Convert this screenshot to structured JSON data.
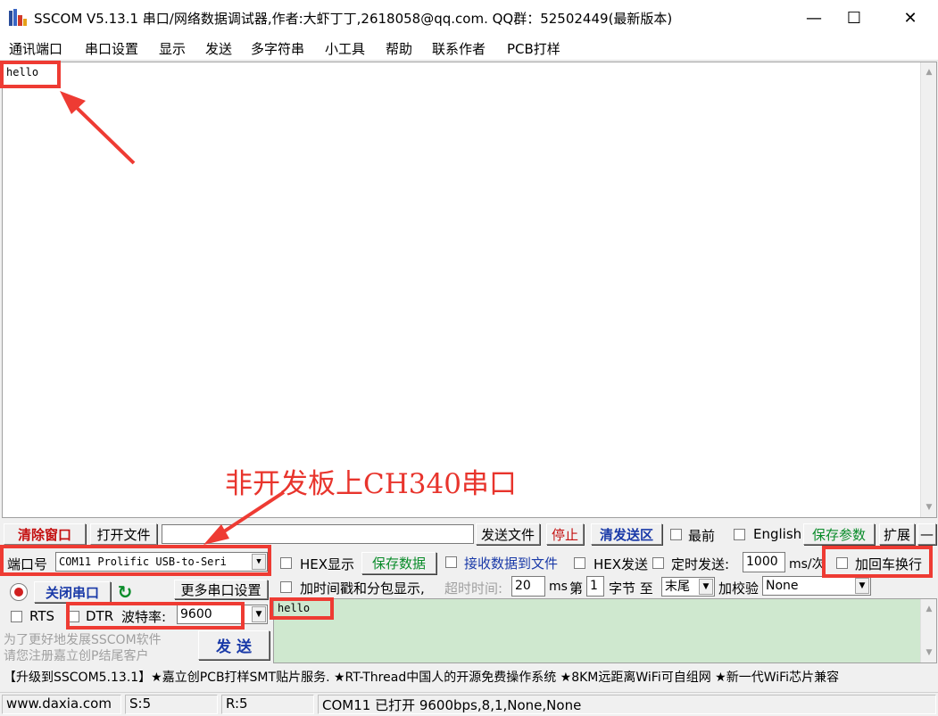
{
  "window": {
    "title": "SSCOM V5.13.1 串口/网络数据调试器,作者:大虾丁丁,2618058@qq.com. QQ群：52502449(最新版本)",
    "minimize": "—",
    "maximize": "☐",
    "close": "✕"
  },
  "menu": [
    "通讯端口",
    "串口设置",
    "显示",
    "发送",
    "多字符串",
    "小工具",
    "帮助",
    "联系作者",
    "PCB打样"
  ],
  "receive": {
    "text": "hello"
  },
  "annotation": {
    "text": "非开发板上CH340串口"
  },
  "row1": {
    "clear_window": "清除窗口",
    "open_file": "打开文件",
    "send_file": "发送文件",
    "stop": "停止",
    "clear_send": "清发送区",
    "last": "最前",
    "english": "English",
    "save_params": "保存参数",
    "expand": "扩展",
    "dash": "—"
  },
  "row2": {
    "port_label": "端口号",
    "port_value": "COM11 Prolific USB-to-Seri",
    "hex_display": "HEX显示",
    "save_data": "保存数据",
    "recv_to_file": "接收数据到文件",
    "hex_send": "HEX发送",
    "timed_send": "定时发送:",
    "interval": "1000",
    "interval_unit": "ms/次",
    "add_crlf": "加回车换行"
  },
  "row3": {
    "close_port": "关闭串口",
    "more_settings": "更多串口设置",
    "timestamp": "加时间戳和分包显示,",
    "timeout_label": "超时时间:",
    "timeout": "20",
    "timeout_unit": "ms",
    "nth": "第",
    "byte_index": "1",
    "byte_label": "字节 至",
    "end": "末尾",
    "checksum_label": "加校验",
    "checksum": "None"
  },
  "row4": {
    "rts": "RTS",
    "dtr": "DTR",
    "baud_label": "波特率:",
    "baud": "9600",
    "send_text": "hello"
  },
  "promo": {
    "line1": "为了更好地发展SSCOM软件",
    "line2": "请您注册嘉立创P结尾客户",
    "send": "发 送"
  },
  "ticker": "【升级到SSCOM5.13.1】★嘉立创PCB打样SMT贴片服务. ★RT-Thread中国人的开源免费操作系统 ★8KM远距离WiFi可自组网 ★新一代WiFi芯片兼容",
  "status": {
    "site": "www.daxia.com",
    "sent": "S:5",
    "recv": "R:5",
    "port_state": "COM11 已打开  9600bps,8,1,None,None"
  },
  "colors": {
    "annotation": "#e8342c",
    "send_area": "#cfe8cf",
    "accent_green": "#0a8c2a"
  }
}
